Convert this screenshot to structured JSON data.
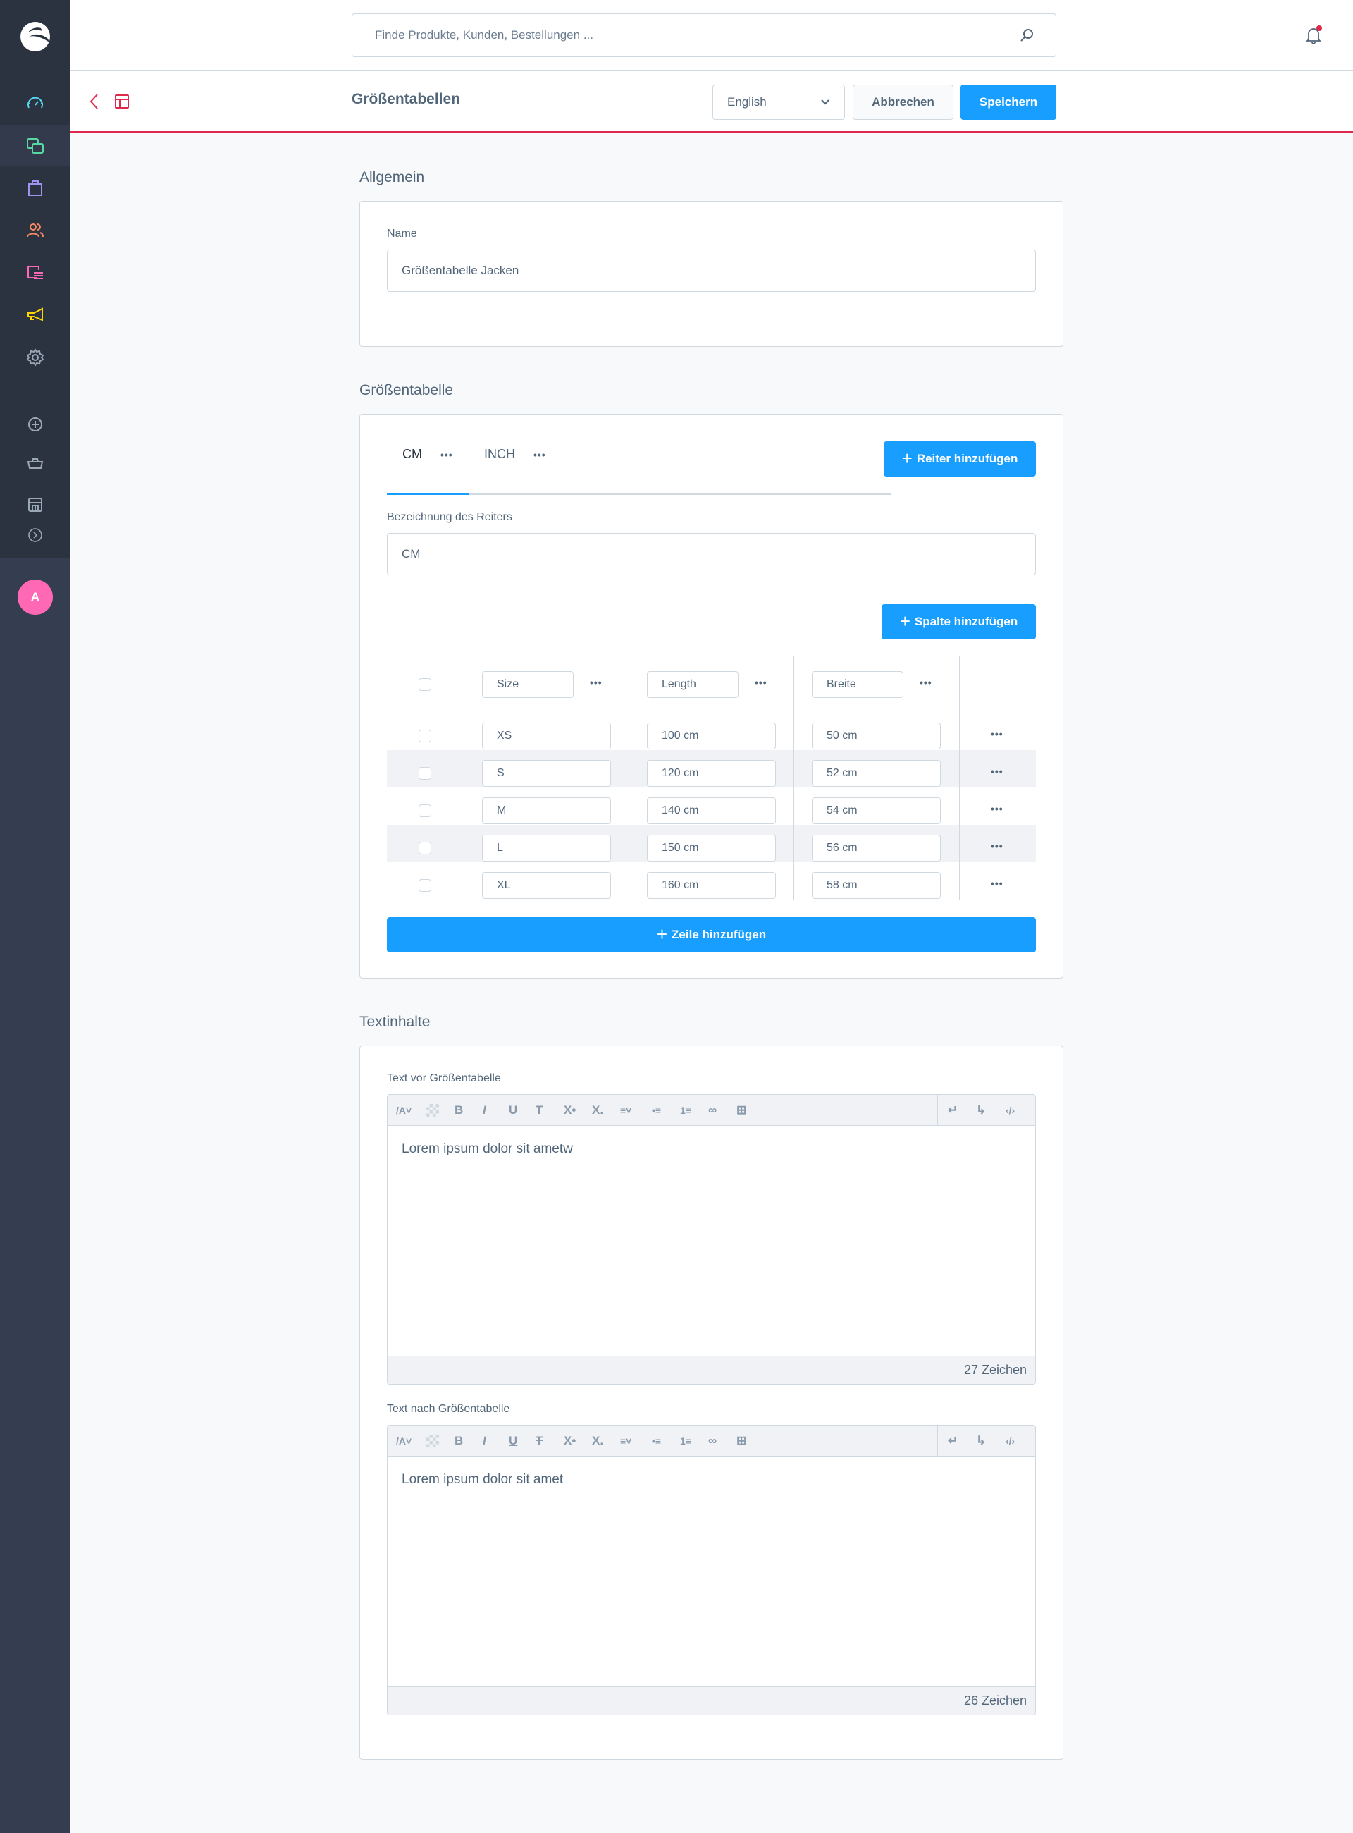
{
  "sidebar": {
    "items": [
      {
        "name": "dashboard",
        "icon": "speedometer-icon",
        "color": "#57d9f5",
        "active": false
      },
      {
        "name": "catalogues",
        "icon": "products-icon",
        "color": "#57d9a3",
        "active": true
      },
      {
        "name": "orders",
        "icon": "shopping-bag-icon",
        "color": "#a092f0",
        "active": false
      },
      {
        "name": "customers",
        "icon": "users-icon",
        "color": "#f88962",
        "active": false
      },
      {
        "name": "content",
        "icon": "content-icon",
        "color": "#ff68b4",
        "active": false
      },
      {
        "name": "marketing",
        "icon": "megaphone-icon",
        "color": "#ffd700",
        "active": false
      },
      {
        "name": "settings",
        "icon": "gear-icon",
        "color": "#9aa8b5",
        "active": false
      },
      {
        "name": "extensions",
        "icon": "plus-circle-icon",
        "color": "#9aa8b5",
        "active": false
      },
      {
        "name": "basket",
        "icon": "basket-icon",
        "color": "#9aa8b5",
        "active": false
      },
      {
        "name": "sales-channel",
        "icon": "storefront-icon",
        "color": "#9aa8b5",
        "active": false
      },
      {
        "name": "expand",
        "icon": "chevron-right-circle-icon",
        "color": "#9aa8b5",
        "active": false
      }
    ],
    "avatar_initial": "A"
  },
  "topbar": {
    "search_placeholder": "Finde Produkte, Kunden, Bestellungen ..."
  },
  "smartbar": {
    "title": "Größentabellen",
    "language": "English",
    "cancel_label": "Abbrechen",
    "save_label": "Speichern"
  },
  "general": {
    "section_title": "Allgemein",
    "name_label": "Name",
    "name_value": "Größentabelle Jacken"
  },
  "size_table": {
    "section_title": "Größentabelle",
    "tabs": [
      {
        "label": "CM",
        "active": true
      },
      {
        "label": "INCH",
        "active": false
      }
    ],
    "add_tab_label": "Reiter hinzufügen",
    "tab_name_label": "Bezeichnung des Reiters",
    "tab_name_value": "CM",
    "add_column_label": "Spalte hinzufügen",
    "columns": [
      "Size",
      "Length",
      "Breite"
    ],
    "rows": [
      [
        "XS",
        "100 cm",
        "50 cm"
      ],
      [
        "S",
        "120 cm",
        "52 cm"
      ],
      [
        "M",
        "140 cm",
        "54 cm"
      ],
      [
        "L",
        "150 cm",
        "56 cm"
      ],
      [
        "XL",
        "160 cm",
        "58 cm"
      ]
    ],
    "add_row_label": "Zeile hinzufügen",
    "dots": "•••"
  },
  "text_content": {
    "section_title": "Textinhalte",
    "before": {
      "label": "Text vor Größentabelle",
      "content": "Lorem ipsum dolor sit ametw",
      "char_count": "27 Zeichen"
    },
    "after": {
      "label": "Text nach Größentabelle",
      "content": "Lorem ipsum dolor sit amet",
      "char_count": "26 Zeichen"
    },
    "toolbar": [
      "font-size",
      "text-color",
      "bold",
      "italic",
      "underline",
      "strikethrough",
      "superscript",
      "subscript",
      "align",
      "bullet-list",
      "numbered-list",
      "link",
      "table",
      "undo",
      "redo",
      "code-view"
    ]
  },
  "colors": {
    "accent": "#189eff",
    "danger": "#de294c",
    "sidebar_bg": "#2b3240",
    "avatar": "#ff68b4"
  }
}
